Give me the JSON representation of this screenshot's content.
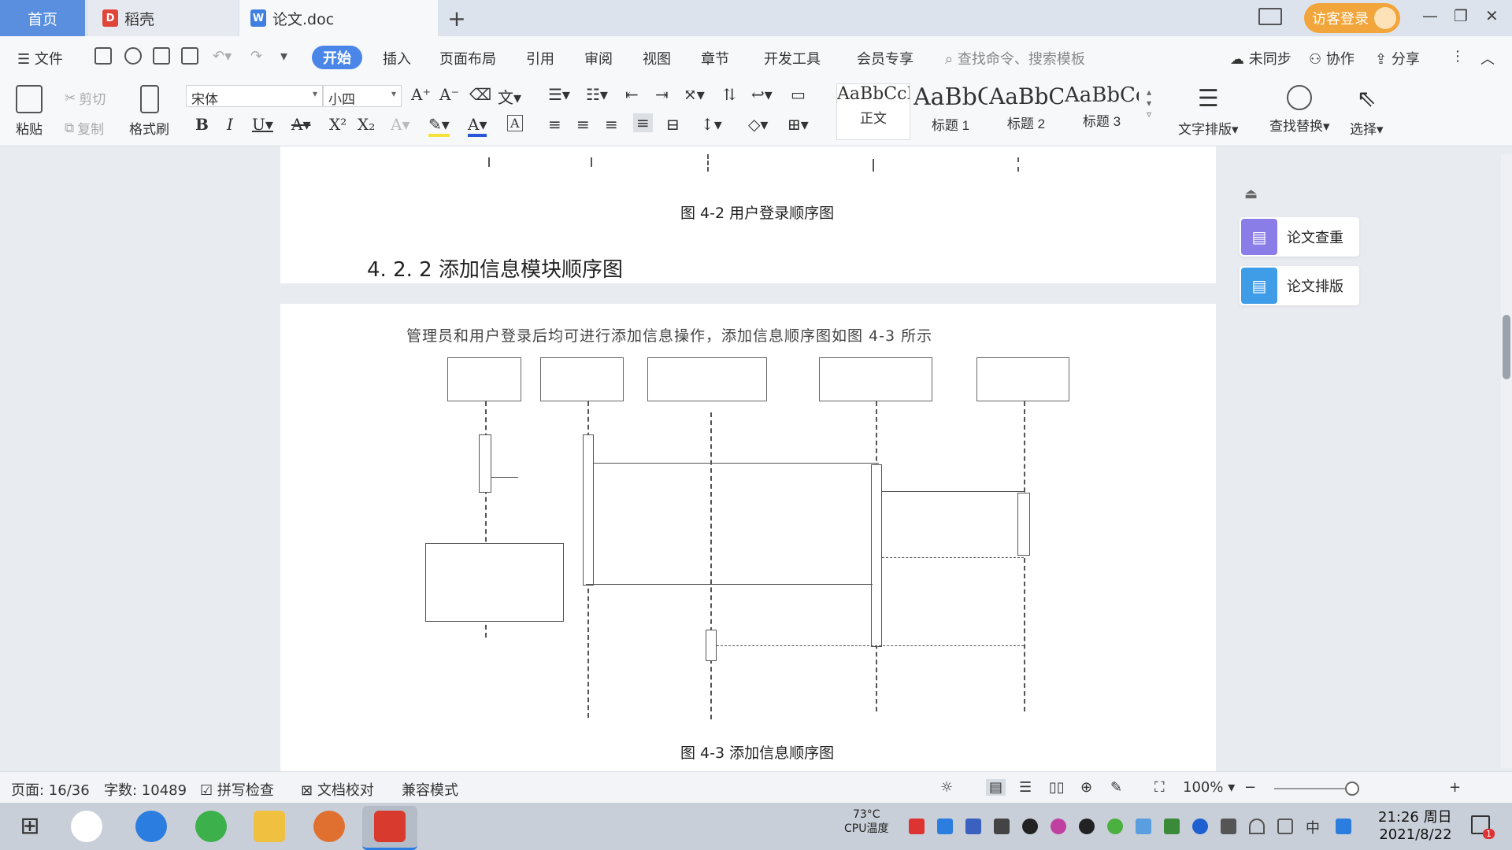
{
  "tabs": {
    "home": "首页",
    "daoke": "稻壳",
    "doc": "论文.doc",
    "add": "+"
  },
  "titlebar": {
    "login": "访客登录"
  },
  "menu": {
    "file": "文件",
    "start": "开始",
    "insert": "插入",
    "layout": "页面布局",
    "reference": "引用",
    "review": "审阅",
    "view": "视图",
    "chapter": "章节",
    "devtools": "开发工具",
    "member": "会员专享",
    "search_placeholder": "查找命令、搜索模板",
    "unsync": "未同步",
    "collab": "协作",
    "share": "分享"
  },
  "ribbon": {
    "paste": "粘贴",
    "cut": "剪切",
    "copy": "复制",
    "format_painter": "格式刷",
    "font_name": "宋体",
    "font_size": "小四",
    "styles": [
      {
        "preview": "AaBbCcI",
        "name": "正文"
      },
      {
        "preview": "AaBbC",
        "name": "标题 1"
      },
      {
        "preview": "AaBbC",
        "name": "标题 2"
      },
      {
        "preview": "AaBbCc",
        "name": "标题 3"
      }
    ],
    "text_layout": "文字排版",
    "find_replace": "查找替换",
    "select": "选择"
  },
  "document": {
    "caption1": "图 4-2 用户登录顺序图",
    "heading": "4. 2. 2 添加信息模块顺序图",
    "paragraph": "管理员和用户登录后均可进行添加信息操作，添加信息顺序图如图 4-3 所示",
    "caption2": "图 4-3 添加信息顺序图"
  },
  "side_panel": {
    "check": "论文查重",
    "format": "论文排版"
  },
  "status": {
    "page": "页面: 16/36",
    "words": "字数: 10489",
    "spell": "拼写检查",
    "proof": "文档校对",
    "compat": "兼容模式",
    "zoom": "100%"
  },
  "taskbar": {
    "temp": "73°C",
    "cpu": "CPU温度",
    "ime": "中",
    "time": "21:26 周日",
    "date": "2021/8/22",
    "notif_count": "1"
  },
  "colors": {
    "accent": "#4a86e8",
    "login": "#f2a53a",
    "home_tab": "#5a8fe0",
    "check_card": "#8a7de8",
    "format_card": "#3f9de8"
  }
}
